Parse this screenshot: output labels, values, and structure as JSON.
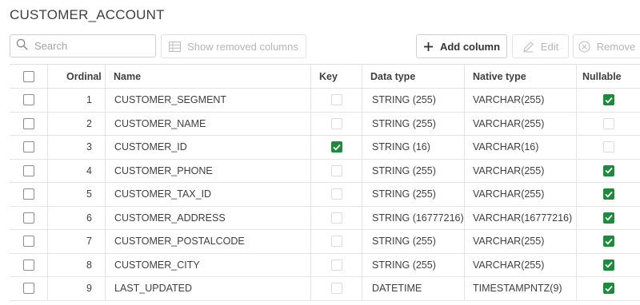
{
  "title": "CUSTOMER_ACCOUNT",
  "toolbar": {
    "search_placeholder": "Search",
    "show_removed": "Show removed columns",
    "add_column": "Add column",
    "edit": "Edit",
    "remove": "Remove"
  },
  "columns": {
    "ordinal": "Ordinal",
    "name": "Name",
    "key": "Key",
    "data_type": "Data type",
    "native_type": "Native type",
    "nullable": "Nullable"
  },
  "rows": [
    {
      "ordinal": "1",
      "name": "CUSTOMER_SEGMENT",
      "key": false,
      "data_type": "STRING (255)",
      "native_type": "VARCHAR(255)",
      "nullable": true
    },
    {
      "ordinal": "2",
      "name": "CUSTOMER_NAME",
      "key": false,
      "data_type": "STRING (255)",
      "native_type": "VARCHAR(255)",
      "nullable": false
    },
    {
      "ordinal": "3",
      "name": "CUSTOMER_ID",
      "key": true,
      "data_type": "STRING (16)",
      "native_type": "VARCHAR(16)",
      "nullable": false
    },
    {
      "ordinal": "4",
      "name": "CUSTOMER_PHONE",
      "key": false,
      "data_type": "STRING (255)",
      "native_type": "VARCHAR(255)",
      "nullable": true
    },
    {
      "ordinal": "5",
      "name": "CUSTOMER_TAX_ID",
      "key": false,
      "data_type": "STRING (255)",
      "native_type": "VARCHAR(255)",
      "nullable": true
    },
    {
      "ordinal": "6",
      "name": "CUSTOMER_ADDRESS",
      "key": false,
      "data_type": "STRING (16777216)",
      "native_type": "VARCHAR(16777216)",
      "nullable": true
    },
    {
      "ordinal": "7",
      "name": "CUSTOMER_POSTALCODE",
      "key": false,
      "data_type": "STRING (255)",
      "native_type": "VARCHAR(255)",
      "nullable": true
    },
    {
      "ordinal": "8",
      "name": "CUSTOMER_CITY",
      "key": false,
      "data_type": "STRING (255)",
      "native_type": "VARCHAR(255)",
      "nullable": true
    },
    {
      "ordinal": "9",
      "name": "LAST_UPDATED",
      "key": false,
      "data_type": "DATETIME",
      "native_type": "TIMESTAMPNTZ(9)",
      "nullable": true
    }
  ],
  "colors": {
    "checked": "#1e8a3c",
    "border": "#e4e4e4",
    "disabled_text": "#b5b5b5"
  },
  "icons": {
    "search": "search-icon",
    "show_removed": "columns-icon",
    "add": "plus-icon",
    "edit": "pencil-icon",
    "remove": "circle-x-icon",
    "sort": "sort-ascending-icon"
  }
}
